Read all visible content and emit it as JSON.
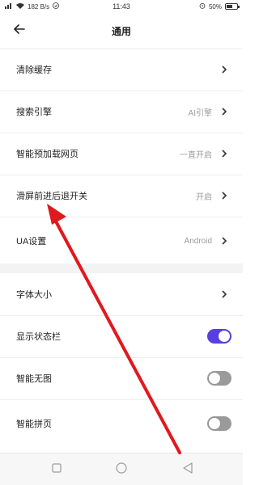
{
  "status_bar": {
    "left": "182 B/s",
    "time": "11:43",
    "battery": "50%"
  },
  "header": {
    "title": "通用"
  },
  "settings": {
    "clear_cache": {
      "label": "清除缓存"
    },
    "search_engine": {
      "label": "搜索引擎",
      "value": "AI引擎"
    },
    "preload": {
      "label": "智能预加载网页",
      "value": "一直开启"
    },
    "swipe_nav": {
      "label": "滑屏前进后退开关",
      "value": "开启"
    },
    "ua": {
      "label": "UA设置",
      "value": "Android"
    },
    "font_size": {
      "label": "字体大小"
    },
    "show_status_bar": {
      "label": "显示状态栏",
      "on": true
    },
    "no_image": {
      "label": "智能无图",
      "on": false
    },
    "page_join": {
      "label": "智能拼页",
      "on": false
    }
  },
  "colors": {
    "toggle_on": "#5a3fe0",
    "toggle_off": "#9a9a9a",
    "annotation_arrow": "#e0191f"
  },
  "icons": {
    "back": "arrow-left-icon",
    "chevron": "chevron-right-icon",
    "nav_recent": "square-icon",
    "nav_home": "circle-icon",
    "nav_back": "triangle-back-icon"
  }
}
